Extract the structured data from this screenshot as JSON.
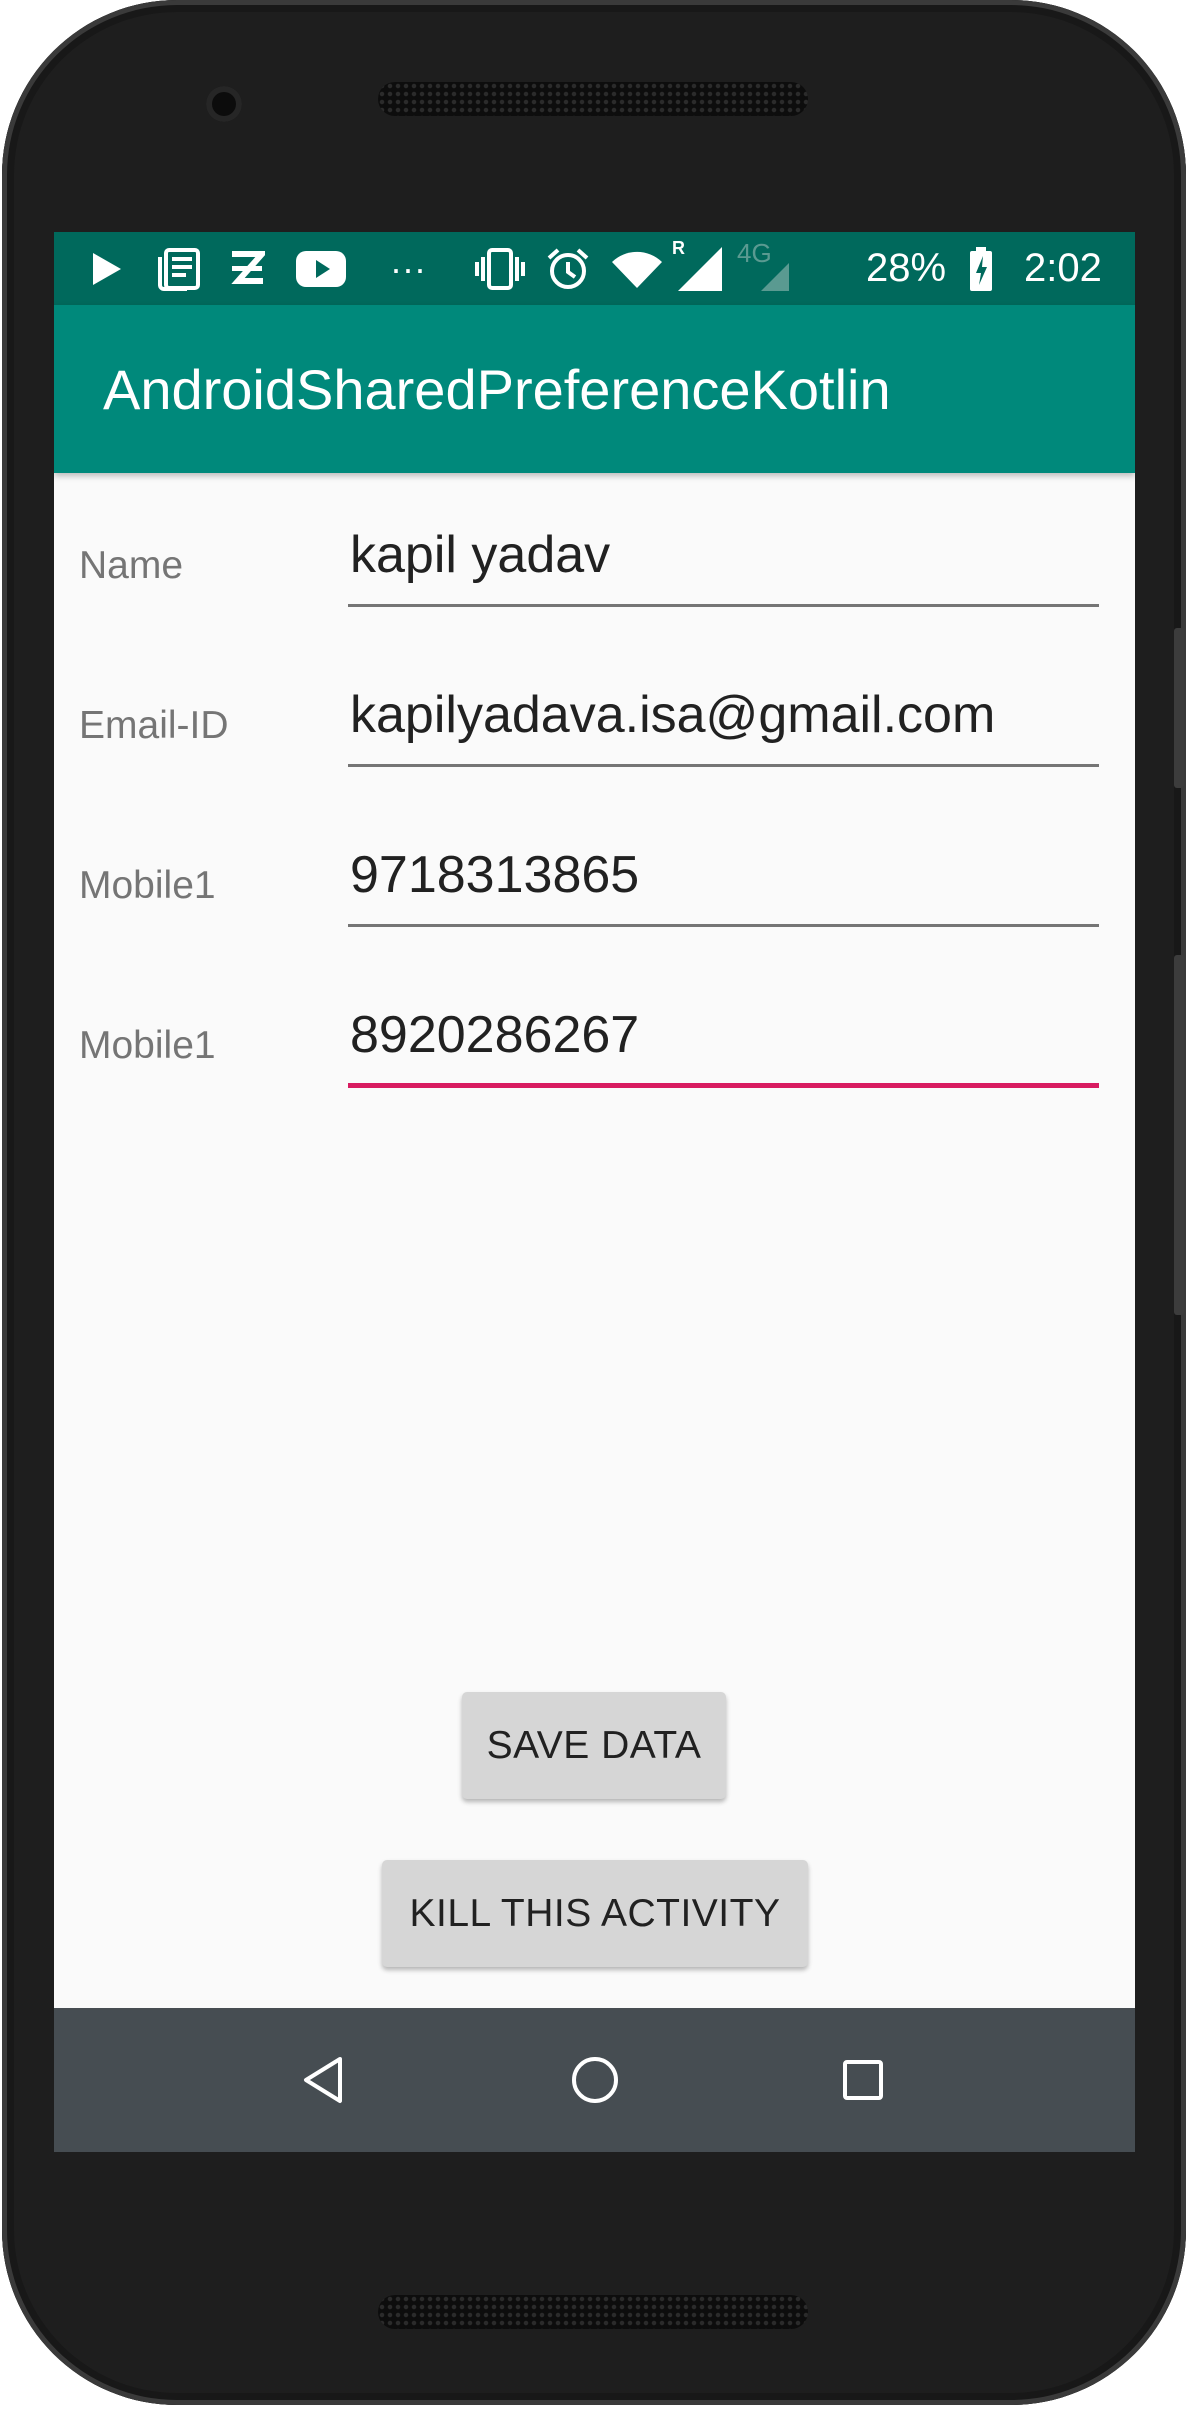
{
  "status_bar": {
    "battery": "28%",
    "time": "2:02",
    "network": "4G",
    "roaming": "R",
    "more": "···",
    "left_icons": [
      "play-store-icon",
      "news-icon",
      "zomato-icon",
      "youtube-icon",
      "more-notifications-icon"
    ],
    "right_icons": [
      "vibrate-icon",
      "alarm-icon",
      "wifi-icon",
      "signal-icon",
      "signal-4g-icon",
      "battery-charging-icon"
    ]
  },
  "app_bar": {
    "title": "AndroidSharedPreferenceKotlin",
    "color": "#00897b",
    "status_color": "#00695c"
  },
  "form": {
    "fields": [
      {
        "label": "Name",
        "value": "kapil yadav"
      },
      {
        "label": "Email-ID",
        "value": "kapilyadava.isa@gmail.com"
      },
      {
        "label": "Mobile1",
        "value": "9718313865"
      },
      {
        "label": "Mobile1",
        "value": "8920286267",
        "focused": true
      }
    ],
    "accent_color": "#d81b60"
  },
  "buttons": {
    "save": "SAVE DATA",
    "kill": "KILL THIS ACTIVITY"
  },
  "nav_bar": {
    "icons": [
      "back-icon",
      "home-icon",
      "recents-icon"
    ],
    "color": "#464d52"
  }
}
